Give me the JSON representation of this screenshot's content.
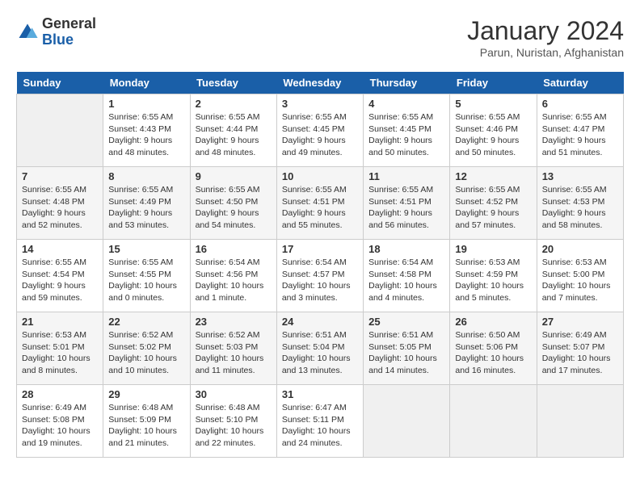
{
  "logo": {
    "line1": "General",
    "line2": "Blue"
  },
  "title": "January 2024",
  "subtitle": "Parun, Nuristan, Afghanistan",
  "days_header": [
    "Sunday",
    "Monday",
    "Tuesday",
    "Wednesday",
    "Thursday",
    "Friday",
    "Saturday"
  ],
  "weeks": [
    [
      {
        "num": "",
        "sunrise": "",
        "sunset": "",
        "daylight": ""
      },
      {
        "num": "1",
        "sunrise": "Sunrise: 6:55 AM",
        "sunset": "Sunset: 4:43 PM",
        "daylight": "Daylight: 9 hours and 48 minutes."
      },
      {
        "num": "2",
        "sunrise": "Sunrise: 6:55 AM",
        "sunset": "Sunset: 4:44 PM",
        "daylight": "Daylight: 9 hours and 48 minutes."
      },
      {
        "num": "3",
        "sunrise": "Sunrise: 6:55 AM",
        "sunset": "Sunset: 4:45 PM",
        "daylight": "Daylight: 9 hours and 49 minutes."
      },
      {
        "num": "4",
        "sunrise": "Sunrise: 6:55 AM",
        "sunset": "Sunset: 4:45 PM",
        "daylight": "Daylight: 9 hours and 50 minutes."
      },
      {
        "num": "5",
        "sunrise": "Sunrise: 6:55 AM",
        "sunset": "Sunset: 4:46 PM",
        "daylight": "Daylight: 9 hours and 50 minutes."
      },
      {
        "num": "6",
        "sunrise": "Sunrise: 6:55 AM",
        "sunset": "Sunset: 4:47 PM",
        "daylight": "Daylight: 9 hours and 51 minutes."
      }
    ],
    [
      {
        "num": "7",
        "sunrise": "Sunrise: 6:55 AM",
        "sunset": "Sunset: 4:48 PM",
        "daylight": "Daylight: 9 hours and 52 minutes."
      },
      {
        "num": "8",
        "sunrise": "Sunrise: 6:55 AM",
        "sunset": "Sunset: 4:49 PM",
        "daylight": "Daylight: 9 hours and 53 minutes."
      },
      {
        "num": "9",
        "sunrise": "Sunrise: 6:55 AM",
        "sunset": "Sunset: 4:50 PM",
        "daylight": "Daylight: 9 hours and 54 minutes."
      },
      {
        "num": "10",
        "sunrise": "Sunrise: 6:55 AM",
        "sunset": "Sunset: 4:51 PM",
        "daylight": "Daylight: 9 hours and 55 minutes."
      },
      {
        "num": "11",
        "sunrise": "Sunrise: 6:55 AM",
        "sunset": "Sunset: 4:51 PM",
        "daylight": "Daylight: 9 hours and 56 minutes."
      },
      {
        "num": "12",
        "sunrise": "Sunrise: 6:55 AM",
        "sunset": "Sunset: 4:52 PM",
        "daylight": "Daylight: 9 hours and 57 minutes."
      },
      {
        "num": "13",
        "sunrise": "Sunrise: 6:55 AM",
        "sunset": "Sunset: 4:53 PM",
        "daylight": "Daylight: 9 hours and 58 minutes."
      }
    ],
    [
      {
        "num": "14",
        "sunrise": "Sunrise: 6:55 AM",
        "sunset": "Sunset: 4:54 PM",
        "daylight": "Daylight: 9 hours and 59 minutes."
      },
      {
        "num": "15",
        "sunrise": "Sunrise: 6:55 AM",
        "sunset": "Sunset: 4:55 PM",
        "daylight": "Daylight: 10 hours and 0 minutes."
      },
      {
        "num": "16",
        "sunrise": "Sunrise: 6:54 AM",
        "sunset": "Sunset: 4:56 PM",
        "daylight": "Daylight: 10 hours and 1 minute."
      },
      {
        "num": "17",
        "sunrise": "Sunrise: 6:54 AM",
        "sunset": "Sunset: 4:57 PM",
        "daylight": "Daylight: 10 hours and 3 minutes."
      },
      {
        "num": "18",
        "sunrise": "Sunrise: 6:54 AM",
        "sunset": "Sunset: 4:58 PM",
        "daylight": "Daylight: 10 hours and 4 minutes."
      },
      {
        "num": "19",
        "sunrise": "Sunrise: 6:53 AM",
        "sunset": "Sunset: 4:59 PM",
        "daylight": "Daylight: 10 hours and 5 minutes."
      },
      {
        "num": "20",
        "sunrise": "Sunrise: 6:53 AM",
        "sunset": "Sunset: 5:00 PM",
        "daylight": "Daylight: 10 hours and 7 minutes."
      }
    ],
    [
      {
        "num": "21",
        "sunrise": "Sunrise: 6:53 AM",
        "sunset": "Sunset: 5:01 PM",
        "daylight": "Daylight: 10 hours and 8 minutes."
      },
      {
        "num": "22",
        "sunrise": "Sunrise: 6:52 AM",
        "sunset": "Sunset: 5:02 PM",
        "daylight": "Daylight: 10 hours and 10 minutes."
      },
      {
        "num": "23",
        "sunrise": "Sunrise: 6:52 AM",
        "sunset": "Sunset: 5:03 PM",
        "daylight": "Daylight: 10 hours and 11 minutes."
      },
      {
        "num": "24",
        "sunrise": "Sunrise: 6:51 AM",
        "sunset": "Sunset: 5:04 PM",
        "daylight": "Daylight: 10 hours and 13 minutes."
      },
      {
        "num": "25",
        "sunrise": "Sunrise: 6:51 AM",
        "sunset": "Sunset: 5:05 PM",
        "daylight": "Daylight: 10 hours and 14 minutes."
      },
      {
        "num": "26",
        "sunrise": "Sunrise: 6:50 AM",
        "sunset": "Sunset: 5:06 PM",
        "daylight": "Daylight: 10 hours and 16 minutes."
      },
      {
        "num": "27",
        "sunrise": "Sunrise: 6:49 AM",
        "sunset": "Sunset: 5:07 PM",
        "daylight": "Daylight: 10 hours and 17 minutes."
      }
    ],
    [
      {
        "num": "28",
        "sunrise": "Sunrise: 6:49 AM",
        "sunset": "Sunset: 5:08 PM",
        "daylight": "Daylight: 10 hours and 19 minutes."
      },
      {
        "num": "29",
        "sunrise": "Sunrise: 6:48 AM",
        "sunset": "Sunset: 5:09 PM",
        "daylight": "Daylight: 10 hours and 21 minutes."
      },
      {
        "num": "30",
        "sunrise": "Sunrise: 6:48 AM",
        "sunset": "Sunset: 5:10 PM",
        "daylight": "Daylight: 10 hours and 22 minutes."
      },
      {
        "num": "31",
        "sunrise": "Sunrise: 6:47 AM",
        "sunset": "Sunset: 5:11 PM",
        "daylight": "Daylight: 10 hours and 24 minutes."
      },
      {
        "num": "",
        "sunrise": "",
        "sunset": "",
        "daylight": ""
      },
      {
        "num": "",
        "sunrise": "",
        "sunset": "",
        "daylight": ""
      },
      {
        "num": "",
        "sunrise": "",
        "sunset": "",
        "daylight": ""
      }
    ]
  ]
}
